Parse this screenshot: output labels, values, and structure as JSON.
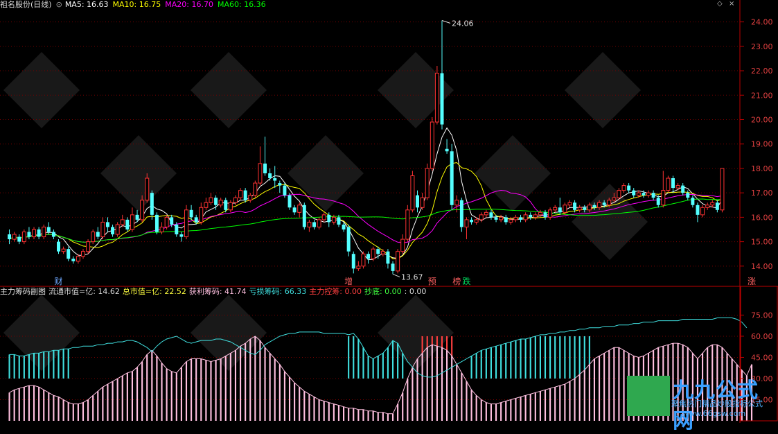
{
  "header": {
    "stock_name": "祖名股份(日线)",
    "ma5": "MA5: 16.63",
    "ma10": "MA10: 16.75",
    "ma20": "MA20: 16.70",
    "ma60": "MA60: 16.36",
    "ma5_color": "#ffffff",
    "ma10_color": "#ffff00",
    "ma20_color": "#ff00ff",
    "ma60_color": "#00ff00"
  },
  "sub_header": {
    "title": "主力筹码副图",
    "float_cap": "流通市值=亿: 14.62",
    "total_cap": "总市值=亿: 22.52",
    "profit_chips": "获利筹码: 41.74",
    "loss_chips": "亏损筹码: 66.33",
    "main_control": "主力控筹: 0.00",
    "bottom_fish": "抄底: 0.00",
    "extra": ": 0.00"
  },
  "watermark": {
    "brand": "九九公式网",
    "slogan": "聚焦热门精品炒股指标公式",
    "url": "www.66gsw.com"
  },
  "chart_data": [
    {
      "type": "candlestick",
      "y_ticks": [
        "24.00",
        "23.00",
        "22.00",
        "21.00",
        "20.00",
        "19.00",
        "18.00",
        "17.00",
        "16.00",
        "15.00",
        "14.00"
      ],
      "ylim": [
        13.2,
        24.5
      ],
      "high_label": "24.06",
      "low_label": "13.67",
      "markers": [
        {
          "text": "财",
          "color": "#6fa8ff",
          "idx": 10
        },
        {
          "text": "增",
          "color": "#ff6060",
          "idx": 69
        },
        {
          "text": "预",
          "color": "#ff6060",
          "idx": 86
        },
        {
          "text": "榜",
          "color": "#ff6060",
          "idx": 91
        },
        {
          "text": "跌",
          "color": "#00e060",
          "idx": 93
        },
        {
          "text": "涨",
          "color": "#ff6060",
          "idx": 151
        }
      ],
      "candles": [
        [
          15.3,
          15.1,
          15.5,
          14.9
        ],
        [
          15.1,
          15.3,
          15.4,
          15.0
        ],
        [
          15.2,
          15.0,
          15.3,
          14.9
        ],
        [
          15.0,
          15.4,
          15.5,
          14.9
        ],
        [
          15.4,
          15.2,
          15.6,
          15.1
        ],
        [
          15.2,
          15.5,
          15.6,
          15.1
        ],
        [
          15.5,
          15.2,
          15.6,
          15.1
        ],
        [
          15.2,
          15.6,
          15.7,
          15.1
        ],
        [
          15.6,
          15.4,
          15.8,
          15.3
        ],
        [
          15.4,
          15.2,
          15.5,
          15.1
        ],
        [
          15.0,
          14.6,
          15.1,
          14.5
        ],
        [
          14.6,
          14.7,
          14.8,
          14.5
        ],
        [
          14.7,
          14.3,
          14.8,
          14.2
        ],
        [
          14.3,
          14.2,
          14.4,
          14.1
        ],
        [
          14.2,
          14.4,
          14.5,
          14.1
        ],
        [
          14.4,
          14.6,
          14.7,
          14.3
        ],
        [
          14.6,
          15.0,
          15.1,
          14.5
        ],
        [
          15.0,
          15.4,
          15.5,
          14.9
        ],
        [
          15.4,
          15.2,
          15.6,
          15.1
        ],
        [
          15.2,
          15.8,
          16.0,
          15.1
        ],
        [
          15.8,
          15.6,
          16.0,
          15.4
        ],
        [
          15.6,
          15.3,
          15.7,
          15.2
        ],
        [
          15.3,
          15.7,
          15.8,
          15.2
        ],
        [
          15.7,
          15.9,
          16.1,
          15.6
        ],
        [
          15.9,
          15.5,
          16.0,
          15.4
        ],
        [
          15.5,
          16.1,
          16.4,
          15.4
        ],
        [
          16.1,
          15.9,
          16.3,
          15.8
        ],
        [
          15.9,
          16.7,
          16.9,
          15.8
        ],
        [
          16.7,
          17.6,
          17.8,
          16.6
        ],
        [
          17.0,
          16.1,
          17.1,
          15.9
        ],
        [
          16.1,
          15.4,
          16.2,
          15.3
        ],
        [
          15.4,
          15.6,
          15.8,
          15.3
        ],
        [
          15.6,
          16.0,
          16.1,
          15.5
        ],
        [
          16.0,
          15.7,
          16.1,
          15.6
        ],
        [
          15.7,
          15.3,
          15.8,
          15.2
        ],
        [
          15.3,
          15.2,
          15.4,
          15.0
        ],
        [
          15.2,
          16.3,
          16.5,
          15.1
        ],
        [
          16.3,
          16.0,
          16.5,
          15.9
        ],
        [
          16.0,
          15.8,
          16.1,
          15.7
        ],
        [
          15.8,
          16.4,
          16.6,
          15.7
        ],
        [
          16.4,
          16.6,
          16.8,
          16.3
        ],
        [
          16.6,
          16.8,
          17.0,
          16.5
        ],
        [
          16.8,
          16.5,
          16.9,
          16.3
        ],
        [
          16.5,
          16.7,
          16.8,
          16.4
        ],
        [
          16.7,
          16.3,
          16.8,
          16.2
        ],
        [
          16.3,
          16.6,
          16.7,
          16.2
        ],
        [
          16.6,
          16.8,
          16.9,
          16.5
        ],
        [
          16.8,
          17.1,
          17.2,
          16.7
        ],
        [
          17.1,
          16.7,
          17.2,
          16.6
        ],
        [
          16.7,
          16.9,
          17.0,
          16.6
        ],
        [
          16.9,
          17.4,
          17.5,
          16.8
        ],
        [
          17.4,
          18.2,
          18.9,
          17.3
        ],
        [
          18.2,
          17.8,
          19.3,
          17.7
        ],
        [
          17.8,
          17.6,
          18.0,
          17.5
        ],
        [
          17.6,
          17.5,
          18.1,
          17.2
        ],
        [
          17.4,
          17.3,
          17.5,
          17.0
        ],
        [
          17.3,
          16.9,
          17.4,
          16.8
        ],
        [
          16.9,
          16.4,
          17.0,
          16.3
        ],
        [
          16.4,
          16.2,
          16.5,
          16.1
        ],
        [
          16.2,
          16.5,
          16.6,
          16.0
        ],
        [
          16.5,
          15.6,
          16.6,
          15.5
        ],
        [
          15.6,
          15.8,
          15.9,
          15.4
        ],
        [
          15.8,
          15.6,
          15.9,
          15.5
        ],
        [
          15.6,
          15.9,
          16.0,
          15.5
        ],
        [
          15.9,
          16.1,
          16.2,
          15.8
        ],
        [
          16.1,
          15.8,
          16.2,
          15.6
        ],
        [
          15.8,
          16.0,
          16.1,
          15.7
        ],
        [
          16.0,
          15.7,
          16.1,
          15.6
        ],
        [
          15.7,
          15.5,
          15.8,
          15.4
        ],
        [
          15.6,
          14.6,
          15.7,
          14.4
        ],
        [
          14.5,
          13.9,
          14.6,
          13.7
        ],
        [
          13.9,
          14.0,
          14.2,
          13.8
        ],
        [
          14.0,
          14.5,
          14.6,
          13.9
        ],
        [
          14.5,
          14.3,
          14.6,
          14.1
        ],
        [
          14.3,
          14.7,
          14.8,
          14.2
        ],
        [
          14.7,
          14.5,
          14.8,
          14.3
        ],
        [
          14.5,
          14.6,
          14.7,
          14.4
        ],
        [
          14.6,
          14.1,
          14.7,
          13.9
        ],
        [
          14.1,
          13.8,
          14.2,
          13.67
        ],
        [
          13.8,
          14.6,
          14.7,
          13.7
        ],
        [
          14.6,
          15.1,
          15.3,
          14.5
        ],
        [
          15.1,
          16.3,
          16.5,
          15.0
        ],
        [
          16.3,
          17.7,
          17.9,
          16.2
        ],
        [
          16.9,
          16.4,
          17.1,
          16.2
        ],
        [
          16.4,
          16.8,
          17.0,
          16.3
        ],
        [
          16.8,
          18.0,
          18.2,
          16.7
        ],
        [
          18.0,
          19.9,
          20.1,
          17.9
        ],
        [
          19.9,
          21.9,
          22.2,
          19.8
        ],
        [
          21.9,
          19.8,
          24.06,
          19.6
        ],
        [
          18.8,
          18.7,
          19.2,
          18.6
        ],
        [
          18.7,
          16.5,
          19.0,
          16.3
        ],
        [
          16.5,
          16.7,
          16.9,
          16.2
        ],
        [
          16.7,
          15.6,
          16.8,
          15.4
        ],
        [
          15.6,
          15.9,
          16.0,
          15.1
        ],
        [
          15.9,
          15.8,
          16.0,
          15.7
        ],
        [
          15.8,
          15.9,
          16.0,
          15.7
        ],
        [
          15.9,
          16.1,
          16.2,
          15.8
        ],
        [
          16.1,
          16.2,
          16.3,
          16.0
        ],
        [
          16.2,
          16.0,
          16.3,
          15.9
        ],
        [
          16.0,
          15.9,
          16.1,
          15.8
        ],
        [
          15.9,
          16.0,
          16.1,
          15.8
        ],
        [
          16.0,
          15.8,
          16.1,
          15.7
        ],
        [
          15.8,
          15.9,
          16.0,
          15.7
        ],
        [
          15.9,
          16.0,
          16.1,
          15.8
        ],
        [
          16.0,
          15.9,
          16.1,
          15.8
        ],
        [
          15.9,
          16.1,
          16.2,
          15.8
        ],
        [
          16.1,
          16.0,
          16.2,
          15.9
        ],
        [
          16.0,
          16.1,
          16.2,
          15.9
        ],
        [
          16.1,
          16.2,
          16.3,
          16.0
        ],
        [
          16.2,
          16.0,
          16.3,
          15.9
        ],
        [
          16.0,
          16.3,
          16.4,
          15.9
        ],
        [
          16.3,
          16.4,
          16.5,
          16.2
        ],
        [
          16.4,
          16.2,
          16.8,
          16.1
        ],
        [
          16.2,
          16.5,
          16.6,
          16.1
        ],
        [
          16.5,
          16.6,
          16.7,
          16.4
        ],
        [
          16.6,
          16.3,
          16.7,
          16.2
        ],
        [
          16.3,
          16.4,
          16.5,
          16.2
        ],
        [
          16.4,
          16.3,
          16.5,
          16.2
        ],
        [
          16.3,
          16.5,
          16.6,
          16.2
        ],
        [
          16.5,
          16.4,
          16.6,
          16.3
        ],
        [
          16.4,
          16.6,
          16.7,
          16.3
        ],
        [
          16.6,
          16.5,
          16.7,
          16.4
        ],
        [
          16.5,
          16.7,
          16.8,
          16.4
        ],
        [
          16.7,
          16.8,
          17.0,
          16.6
        ],
        [
          16.8,
          17.1,
          17.2,
          16.7
        ],
        [
          17.1,
          17.3,
          17.4,
          17.0
        ],
        [
          17.3,
          17.1,
          17.4,
          17.0
        ],
        [
          17.1,
          16.9,
          17.2,
          16.8
        ],
        [
          16.9,
          17.0,
          17.1,
          16.8
        ],
        [
          17.0,
          16.9,
          17.1,
          16.8
        ],
        [
          16.9,
          17.0,
          17.1,
          16.8
        ],
        [
          17.0,
          16.8,
          17.1,
          16.7
        ],
        [
          16.8,
          16.5,
          16.9,
          16.4
        ],
        [
          16.5,
          17.1,
          17.9,
          16.4
        ],
        [
          17.1,
          17.6,
          17.7,
          17.0
        ],
        [
          17.6,
          17.2,
          17.7,
          17.0
        ],
        [
          17.2,
          17.3,
          17.4,
          17.1
        ],
        [
          17.3,
          17.0,
          17.4,
          16.9
        ],
        [
          17.0,
          16.8,
          17.1,
          16.7
        ],
        [
          16.8,
          16.5,
          16.9,
          16.4
        ],
        [
          16.5,
          16.1,
          16.6,
          15.8
        ],
        [
          16.1,
          16.4,
          16.5,
          16.0
        ],
        [
          16.4,
          16.5,
          16.6,
          16.3
        ],
        [
          16.5,
          16.6,
          16.7,
          16.4
        ],
        [
          16.6,
          16.3,
          16.7,
          16.2
        ],
        [
          16.3,
          18.0,
          18.0,
          16.2
        ]
      ],
      "ma_series": [
        {
          "name": "MA5",
          "color": "#ffffff"
        },
        {
          "name": "MA10",
          "color": "#ffff00"
        },
        {
          "name": "MA20",
          "color": "#ff00ff"
        },
        {
          "name": "MA60",
          "color": "#00ff00"
        }
      ]
    },
    {
      "type": "bar+line",
      "y_ticks": [
        "75.00",
        "60.00",
        "45.00",
        "30.00",
        "15.00"
      ],
      "ylim": [
        0,
        88
      ],
      "profit_chips": [
        20,
        22,
        23,
        24,
        25,
        25,
        24,
        22,
        20,
        18,
        17,
        15,
        13,
        12,
        12,
        13,
        15,
        18,
        21,
        24,
        26,
        28,
        30,
        32,
        34,
        35,
        38,
        42,
        47,
        50,
        46,
        41,
        37,
        35,
        34,
        38,
        42,
        44,
        44,
        44,
        43,
        42,
        43,
        44,
        46,
        48,
        50,
        53,
        55,
        58,
        60,
        57,
        52,
        48,
        44,
        40,
        35,
        31,
        27,
        24,
        21,
        19,
        17,
        15,
        14,
        13,
        12,
        11,
        10,
        9,
        9,
        8,
        8,
        7,
        7,
        6,
        6,
        5,
        5,
        12,
        20,
        30,
        38,
        44,
        48,
        52,
        54,
        53,
        52,
        50,
        46,
        40,
        34,
        28,
        22,
        18,
        15,
        13,
        12,
        12,
        13,
        14,
        15,
        16,
        17,
        18,
        19,
        20,
        21,
        22,
        23,
        24,
        25,
        26,
        28,
        30,
        33,
        36,
        40,
        44,
        46,
        48,
        50,
        52,
        52,
        50,
        48,
        46,
        45,
        46,
        48,
        50,
        52,
        53,
        54,
        55,
        55,
        54,
        52,
        48,
        44,
        48,
        52,
        54,
        54,
        52,
        48,
        44,
        40,
        36,
        32,
        40
      ],
      "loss_chips": [
        47,
        47,
        46,
        46,
        47,
        48,
        48,
        49,
        49,
        50,
        50,
        51,
        51,
        52,
        52,
        53,
        53,
        53,
        54,
        54,
        55,
        55,
        56,
        56,
        57,
        57,
        56,
        54,
        52,
        49,
        53,
        56,
        58,
        59,
        60,
        58,
        56,
        55,
        56,
        57,
        57,
        57,
        58,
        58,
        57,
        56,
        54,
        52,
        50,
        48,
        47,
        50,
        54,
        56,
        58,
        60,
        61,
        62,
        62,
        63,
        63,
        63,
        63,
        63,
        62,
        62,
        62,
        62,
        62,
        61,
        62,
        58,
        52,
        46,
        44,
        46,
        48,
        52,
        57,
        55,
        48,
        42,
        38,
        34,
        32,
        31,
        31,
        32,
        34,
        36,
        38,
        40,
        42,
        44,
        46,
        48,
        50,
        51,
        52,
        53,
        54,
        55,
        56,
        57,
        58,
        58,
        59,
        60,
        61,
        61,
        62,
        62,
        63,
        63,
        64,
        64,
        65,
        65,
        66,
        66,
        66,
        67,
        67,
        67,
        68,
        68,
        68,
        69,
        69,
        70,
        70,
        70,
        71,
        71,
        71,
        71,
        71,
        72,
        72,
        72,
        72,
        72,
        72,
        72,
        73,
        73,
        73,
        73,
        72,
        70,
        66
      ],
      "profit_color": "#ffc0e0",
      "loss_color": "#40e0e0",
      "main_color": "#ff4040"
    }
  ]
}
